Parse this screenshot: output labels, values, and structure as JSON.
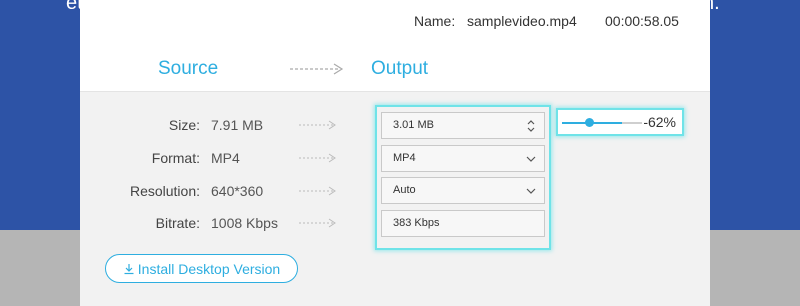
{
  "background": {
    "left_fragment": "et",
    "right_fragment": "n."
  },
  "header": {
    "name_label": "Name:",
    "file_name": "samplevideo.mp4",
    "duration": "00:00:58.05",
    "source_heading": "Source",
    "output_heading": "Output"
  },
  "rows": [
    {
      "label": "Size:",
      "source_value": "7.91 MB",
      "output_value": "3.01  MB",
      "control": "stepper"
    },
    {
      "label": "Format:",
      "source_value": "MP4",
      "output_value": "MP4",
      "control": "dropdown"
    },
    {
      "label": "Resolution:",
      "source_value": "640*360",
      "output_value": "Auto",
      "control": "dropdown"
    },
    {
      "label": "Bitrate:",
      "source_value": "1008 Kbps",
      "output_value": "383 Kbps",
      "control": "readonly"
    }
  ],
  "size_slider": {
    "percent_label": "-62%",
    "fill_fraction": 0.38
  },
  "install_button": {
    "label": "Install Desktop Version",
    "icon": "download-icon"
  },
  "colors": {
    "accent": "#2eaee0",
    "page_bg": "#2d53a6",
    "highlight": "#6fe3e8"
  }
}
